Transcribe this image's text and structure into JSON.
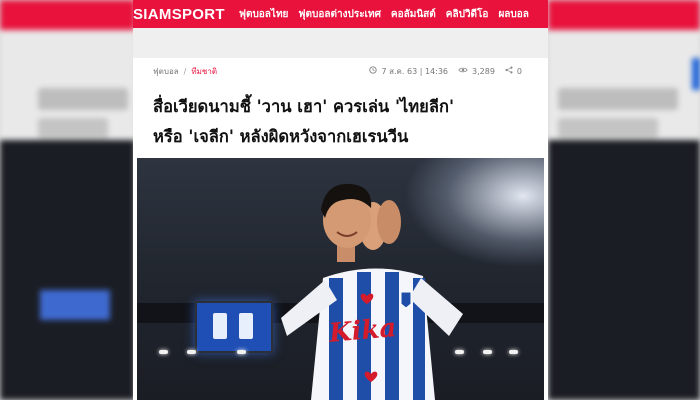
{
  "site": {
    "logo": "SIAMSPORT",
    "nav": [
      "ฟุตบอลไทย",
      "ฟุตบอลต่างประเทศ",
      "คอลัมนิสต์",
      "คลิปวิดีโอ",
      "ผลบอล"
    ],
    "brand_color": "#e8123c"
  },
  "article": {
    "breadcrumb": [
      "ฟุตบอล",
      "ทีมชาติ"
    ],
    "breadcrumb_sep": "/",
    "date": "7 ส.ค. 63 | 14:36",
    "views": "3,289",
    "shares": "0",
    "title_line1": "สื่อเวียดนามชี้ 'วาน เฮา' ควรเล่น 'ไทยลีก'",
    "title_line2": "หรือ 'เจลีก' หลังผิดหวังจากเฮเรนวีน",
    "photo_sponsor": "Kika"
  },
  "icons": {
    "clock": "clock-icon",
    "eye": "eye-icon",
    "share": "share-icon"
  }
}
